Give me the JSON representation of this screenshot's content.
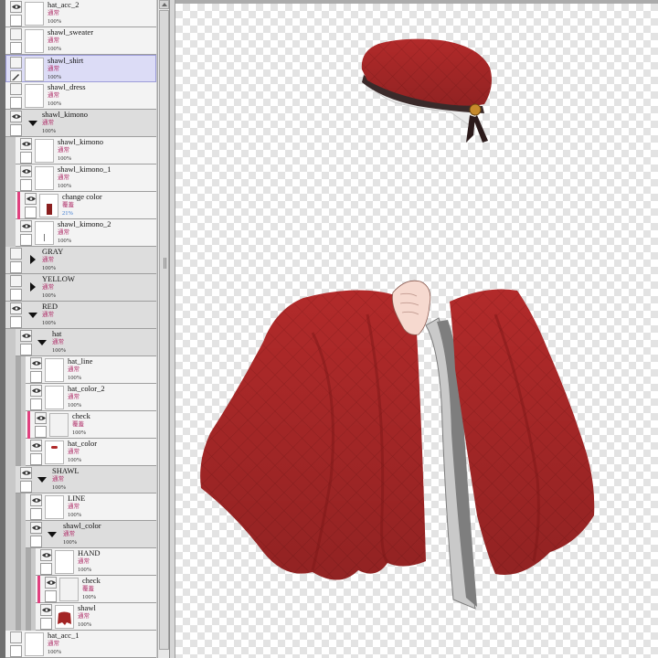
{
  "layers": [
    {
      "name": "hat_acc_2",
      "mode": "通常",
      "opacity": "100%"
    },
    {
      "name": "shawl_sweater",
      "mode": "通常",
      "opacity": "100%"
    },
    {
      "name": "shawl_shirt",
      "mode": "通常",
      "opacity": "100%"
    },
    {
      "name": "shawl_dress",
      "mode": "通常",
      "opacity": "100%"
    },
    {
      "name": "shawl_kimono",
      "mode": "通常",
      "opacity": "100%"
    },
    {
      "name": "shawl_kimono",
      "mode": "通常",
      "opacity": "100%"
    },
    {
      "name": "shawl_kimono_1",
      "mode": "通常",
      "opacity": "100%"
    },
    {
      "name": "change color",
      "mode": "覆蓋",
      "opacity": "21%"
    },
    {
      "name": "shawl_kimono_2",
      "mode": "通常",
      "opacity": "100%"
    },
    {
      "name": "GRAY",
      "mode": "通常",
      "opacity": "100%"
    },
    {
      "name": "YELLOW",
      "mode": "通常",
      "opacity": "100%"
    },
    {
      "name": "RED",
      "mode": "通常",
      "opacity": "100%"
    },
    {
      "name": "hat",
      "mode": "通常",
      "opacity": "100%"
    },
    {
      "name": "hat_line",
      "mode": "通常",
      "opacity": "100%"
    },
    {
      "name": "hat_color_2",
      "mode": "通常",
      "opacity": "100%"
    },
    {
      "name": "check",
      "mode": "覆蓋",
      "opacity": "100%"
    },
    {
      "name": "hat_color",
      "mode": "通常",
      "opacity": "100%"
    },
    {
      "name": "SHAWL",
      "mode": "通常",
      "opacity": "100%"
    },
    {
      "name": "LINE",
      "mode": "通常",
      "opacity": "100%"
    },
    {
      "name": "shawl_color",
      "mode": "通常",
      "opacity": "100%"
    },
    {
      "name": "HAND",
      "mode": "通常",
      "opacity": "100%"
    },
    {
      "name": "check",
      "mode": "覆蓋",
      "opacity": "100%"
    },
    {
      "name": "shawl",
      "mode": "通常",
      "opacity": "100%"
    },
    {
      "name": "hat_acc_1",
      "mode": "通常",
      "opacity": "100%"
    }
  ],
  "selected_layer": "shawl_shirt",
  "colors": {
    "mode_text": "#b0306a",
    "clip_marker": "#e0407e",
    "selection": "#dcdcf6",
    "artwork_red": "#b02a2a"
  },
  "icons": [
    "eye-icon",
    "pen-icon",
    "folder-expanded-icon",
    "folder-collapsed-icon"
  ]
}
